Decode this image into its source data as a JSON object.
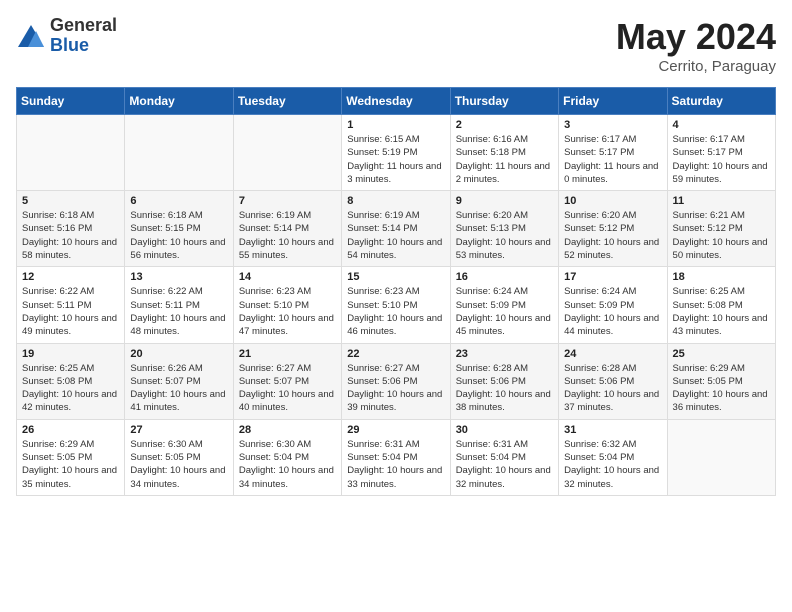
{
  "logo": {
    "general": "General",
    "blue": "Blue"
  },
  "title": {
    "month_year": "May 2024",
    "location": "Cerrito, Paraguay"
  },
  "days_of_week": [
    "Sunday",
    "Monday",
    "Tuesday",
    "Wednesday",
    "Thursday",
    "Friday",
    "Saturday"
  ],
  "weeks": [
    [
      {
        "day": "",
        "info": ""
      },
      {
        "day": "",
        "info": ""
      },
      {
        "day": "",
        "info": ""
      },
      {
        "day": "1",
        "info": "Sunrise: 6:15 AM\nSunset: 5:19 PM\nDaylight: 11 hours and 3 minutes."
      },
      {
        "day": "2",
        "info": "Sunrise: 6:16 AM\nSunset: 5:18 PM\nDaylight: 11 hours and 2 minutes."
      },
      {
        "day": "3",
        "info": "Sunrise: 6:17 AM\nSunset: 5:17 PM\nDaylight: 11 hours and 0 minutes."
      },
      {
        "day": "4",
        "info": "Sunrise: 6:17 AM\nSunset: 5:17 PM\nDaylight: 10 hours and 59 minutes."
      }
    ],
    [
      {
        "day": "5",
        "info": "Sunrise: 6:18 AM\nSunset: 5:16 PM\nDaylight: 10 hours and 58 minutes."
      },
      {
        "day": "6",
        "info": "Sunrise: 6:18 AM\nSunset: 5:15 PM\nDaylight: 10 hours and 56 minutes."
      },
      {
        "day": "7",
        "info": "Sunrise: 6:19 AM\nSunset: 5:14 PM\nDaylight: 10 hours and 55 minutes."
      },
      {
        "day": "8",
        "info": "Sunrise: 6:19 AM\nSunset: 5:14 PM\nDaylight: 10 hours and 54 minutes."
      },
      {
        "day": "9",
        "info": "Sunrise: 6:20 AM\nSunset: 5:13 PM\nDaylight: 10 hours and 53 minutes."
      },
      {
        "day": "10",
        "info": "Sunrise: 6:20 AM\nSunset: 5:12 PM\nDaylight: 10 hours and 52 minutes."
      },
      {
        "day": "11",
        "info": "Sunrise: 6:21 AM\nSunset: 5:12 PM\nDaylight: 10 hours and 50 minutes."
      }
    ],
    [
      {
        "day": "12",
        "info": "Sunrise: 6:22 AM\nSunset: 5:11 PM\nDaylight: 10 hours and 49 minutes."
      },
      {
        "day": "13",
        "info": "Sunrise: 6:22 AM\nSunset: 5:11 PM\nDaylight: 10 hours and 48 minutes."
      },
      {
        "day": "14",
        "info": "Sunrise: 6:23 AM\nSunset: 5:10 PM\nDaylight: 10 hours and 47 minutes."
      },
      {
        "day": "15",
        "info": "Sunrise: 6:23 AM\nSunset: 5:10 PM\nDaylight: 10 hours and 46 minutes."
      },
      {
        "day": "16",
        "info": "Sunrise: 6:24 AM\nSunset: 5:09 PM\nDaylight: 10 hours and 45 minutes."
      },
      {
        "day": "17",
        "info": "Sunrise: 6:24 AM\nSunset: 5:09 PM\nDaylight: 10 hours and 44 minutes."
      },
      {
        "day": "18",
        "info": "Sunrise: 6:25 AM\nSunset: 5:08 PM\nDaylight: 10 hours and 43 minutes."
      }
    ],
    [
      {
        "day": "19",
        "info": "Sunrise: 6:25 AM\nSunset: 5:08 PM\nDaylight: 10 hours and 42 minutes."
      },
      {
        "day": "20",
        "info": "Sunrise: 6:26 AM\nSunset: 5:07 PM\nDaylight: 10 hours and 41 minutes."
      },
      {
        "day": "21",
        "info": "Sunrise: 6:27 AM\nSunset: 5:07 PM\nDaylight: 10 hours and 40 minutes."
      },
      {
        "day": "22",
        "info": "Sunrise: 6:27 AM\nSunset: 5:06 PM\nDaylight: 10 hours and 39 minutes."
      },
      {
        "day": "23",
        "info": "Sunrise: 6:28 AM\nSunset: 5:06 PM\nDaylight: 10 hours and 38 minutes."
      },
      {
        "day": "24",
        "info": "Sunrise: 6:28 AM\nSunset: 5:06 PM\nDaylight: 10 hours and 37 minutes."
      },
      {
        "day": "25",
        "info": "Sunrise: 6:29 AM\nSunset: 5:05 PM\nDaylight: 10 hours and 36 minutes."
      }
    ],
    [
      {
        "day": "26",
        "info": "Sunrise: 6:29 AM\nSunset: 5:05 PM\nDaylight: 10 hours and 35 minutes."
      },
      {
        "day": "27",
        "info": "Sunrise: 6:30 AM\nSunset: 5:05 PM\nDaylight: 10 hours and 34 minutes."
      },
      {
        "day": "28",
        "info": "Sunrise: 6:30 AM\nSunset: 5:04 PM\nDaylight: 10 hours and 34 minutes."
      },
      {
        "day": "29",
        "info": "Sunrise: 6:31 AM\nSunset: 5:04 PM\nDaylight: 10 hours and 33 minutes."
      },
      {
        "day": "30",
        "info": "Sunrise: 6:31 AM\nSunset: 5:04 PM\nDaylight: 10 hours and 32 minutes."
      },
      {
        "day": "31",
        "info": "Sunrise: 6:32 AM\nSunset: 5:04 PM\nDaylight: 10 hours and 32 minutes."
      },
      {
        "day": "",
        "info": ""
      }
    ]
  ]
}
